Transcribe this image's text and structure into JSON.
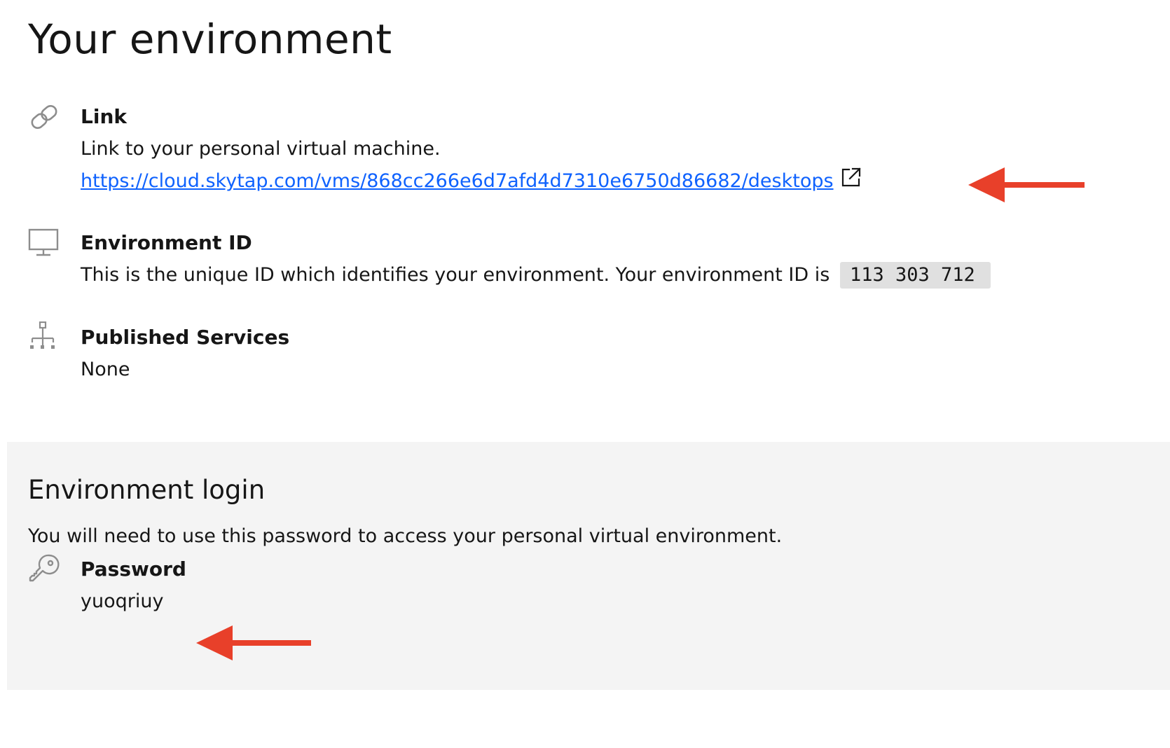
{
  "page": {
    "title": "Your environment"
  },
  "link_section": {
    "icon": "link-icon",
    "heading": "Link",
    "description": "Link to your personal virtual machine.",
    "url": "https://cloud.skytap.com/vms/868cc266e6d7afd4d7310e6750d86682/desktops",
    "external_icon": "launch-icon"
  },
  "environment_id_section": {
    "icon": "monitor-icon",
    "heading": "Environment ID",
    "description": "This is the unique ID which identifies your environment. Your environment ID is",
    "id_value": "113 303 712"
  },
  "published_services_section": {
    "icon": "network-tree-icon",
    "heading": "Published Services",
    "value": "None"
  },
  "login_panel": {
    "title": "Environment login",
    "description": "You will need to use this password to access your personal virtual environment.",
    "password": {
      "icon": "key-icon",
      "heading": "Password",
      "value": "yuoqriuy"
    }
  },
  "annotations": {
    "arrow_color": "#e8402a",
    "arrow_icon": "left-arrow-icon"
  },
  "colors": {
    "link": "#0f62fe",
    "panel_bg": "#f4f4f4",
    "code_bg": "#e0e0e0",
    "icon": "#8d8d8d",
    "text": "#161616"
  }
}
